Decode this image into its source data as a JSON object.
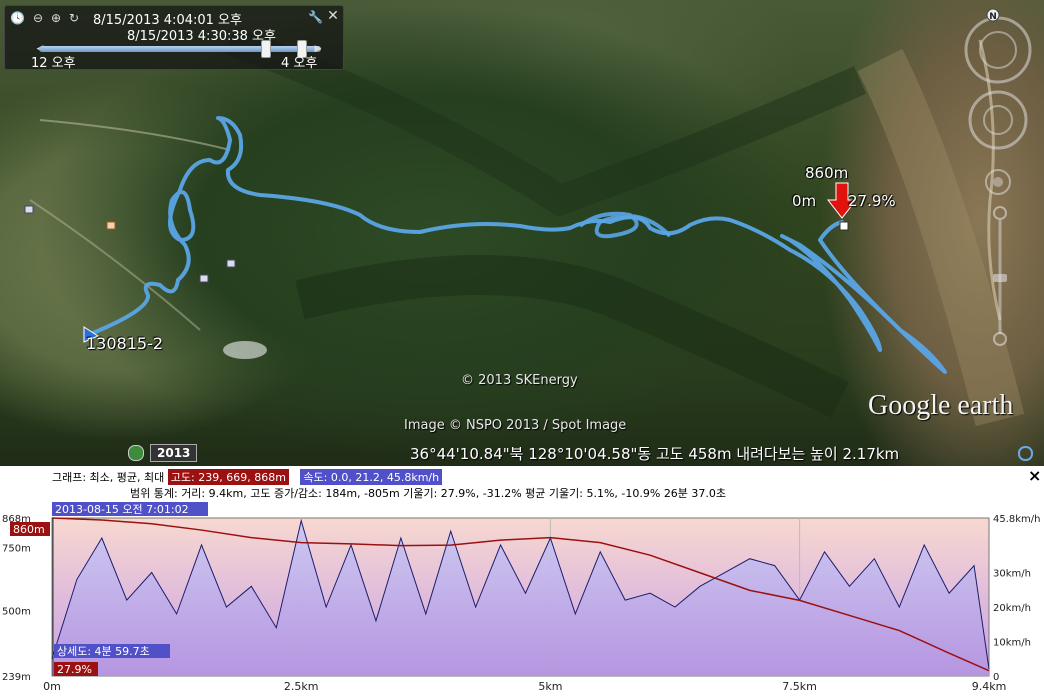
{
  "timebar": {
    "start": "8/15/2013   4:04:01 오후",
    "end": "8/15/2013   4:30:38 오후",
    "left_tick": "12 오후",
    "right_tick": "4 오후",
    "range_start_fraction": 0.8,
    "range_end_fraction": 0.93
  },
  "map": {
    "track_name": "130815-2",
    "marker_altitude": "860m",
    "marker_distance": "0m",
    "marker_slope": "27.9%",
    "copyright_skenergy": "© 2013 SKEnergy",
    "image_credit": "Image © NSPO 2013 / Spot Image",
    "google_earth_logo": "Google earth",
    "historical_year": "2013",
    "track_color": "#5aa5e6"
  },
  "status": {
    "coordinates": "36°44'10.84\"북  128°10'04.58\"동  고도    458m    내려다보는 높이    2.17km"
  },
  "profile": {
    "close_label": "×",
    "graph_label": "그래프: 최소, 평균, 최대",
    "altitude_chip": "고도: 239, 669, 868m",
    "speed_chip": "속도: 0.0, 21.2, 45.8km/h",
    "range_label": "범위 통계:",
    "distance_stat": "거리: 9.4km",
    "gain_loss_stat": "고도 증가/감소: 184m, -805m",
    "slope_stat": "기울기: 27.9%, -31.2%",
    "avg_slope_stat": "평균 기울기: 5.1%, -10.9%",
    "duration_stat": "26분 37.0초",
    "timestamp": "2013-08-15 오전 7:01:02",
    "altitude_cursor": "860m",
    "elapsed": "상세도: 4분 59.7초",
    "slope_cursor": "27.9%",
    "altitude_color": "#9b1010",
    "speed_color": "#5050c8"
  },
  "chart_data": {
    "type": "area",
    "x_unit": "km",
    "x_ticks": [
      "0m",
      "2.5km",
      "5km",
      "7.5km",
      "9.4km"
    ],
    "left_axis": {
      "label": "altitude",
      "ticks": [
        "868m",
        "750m",
        "500m",
        "239m"
      ],
      "ylim": [
        239,
        868
      ]
    },
    "right_axis": {
      "label": "speed",
      "ticks": [
        "45.8km/h",
        "30km/h",
        "20km/h",
        "10km/h",
        "0"
      ],
      "ylim": [
        0,
        45.8
      ]
    },
    "series": [
      {
        "name": "고도",
        "x": [
          0,
          0.5,
          1.0,
          1.5,
          2.0,
          2.5,
          3.0,
          3.5,
          4.0,
          4.5,
          5.0,
          5.5,
          6.0,
          6.5,
          7.0,
          7.5,
          8.0,
          8.5,
          9.0,
          9.4
        ],
        "values": [
          868,
          860,
          845,
          820,
          790,
          770,
          765,
          758,
          760,
          780,
          790,
          770,
          720,
          650,
          580,
          540,
          480,
          420,
          330,
          260
        ]
      },
      {
        "name": "속도",
        "x": [
          0,
          0.25,
          0.5,
          0.75,
          1.0,
          1.25,
          1.5,
          1.75,
          2.0,
          2.25,
          2.5,
          2.75,
          3.0,
          3.25,
          3.5,
          3.75,
          4.0,
          4.25,
          4.5,
          4.75,
          5.0,
          5.25,
          5.5,
          5.75,
          6.0,
          6.25,
          6.5,
          6.75,
          7.0,
          7.25,
          7.5,
          7.75,
          8.0,
          8.25,
          8.5,
          8.75,
          9.0,
          9.25,
          9.4
        ],
        "values": [
          5,
          28,
          40,
          22,
          30,
          18,
          38,
          20,
          26,
          14,
          45,
          20,
          38,
          16,
          40,
          18,
          42,
          20,
          38,
          24,
          40,
          18,
          36,
          22,
          24,
          20,
          26,
          30,
          34,
          32,
          22,
          36,
          26,
          34,
          20,
          38,
          24,
          32,
          2
        ]
      }
    ]
  }
}
